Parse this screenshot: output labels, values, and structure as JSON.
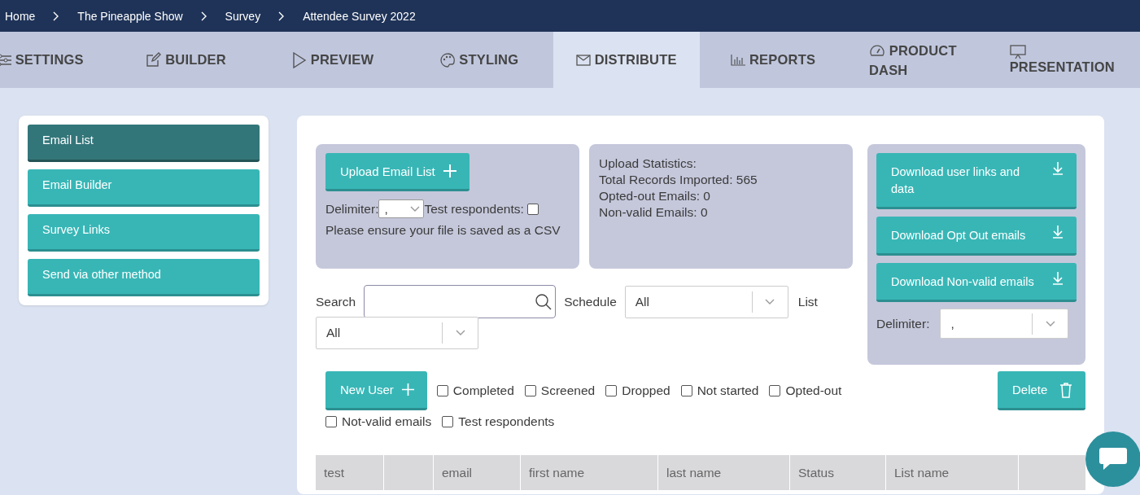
{
  "breadcrumbs": [
    "Home",
    "The Pineapple Show",
    "Survey",
    "Attendee Survey 2022"
  ],
  "tabs": [
    {
      "label": "SETTINGS",
      "selected": false
    },
    {
      "label": "BUILDER",
      "selected": false
    },
    {
      "label": "PREVIEW",
      "selected": false
    },
    {
      "label": "STYLING",
      "selected": false
    },
    {
      "label": "DISTRIBUTE",
      "selected": true
    },
    {
      "label": "REPORTS",
      "selected": false
    },
    {
      "label": "PRODUCT DASH",
      "selected": false
    },
    {
      "label": "PRESENTATION",
      "selected": false
    }
  ],
  "sidebar": {
    "items": [
      {
        "label": "Email List",
        "selected": true
      },
      {
        "label": "Email Builder",
        "selected": false
      },
      {
        "label": "Survey Links",
        "selected": false
      },
      {
        "label": "Send via other method",
        "selected": false
      }
    ]
  },
  "upload": {
    "button": "Upload Email List",
    "delimiter_label": "Delimiter:",
    "delimiter_value": ",",
    "test_label": "Test respondents:",
    "test_checked": false,
    "note": "Please ensure your file is saved as a CSV"
  },
  "statistics": [
    "Upload Statistics:",
    "Total Records Imported: 565",
    "Opted-out Emails: 0",
    "Non-valid Emails: 0"
  ],
  "downloads": {
    "buttons": [
      "Download user links and data",
      "Download Opt Out emails",
      "Download Non-valid emails"
    ],
    "delimiter_label": "Delimiter:",
    "delimiter_value": ","
  },
  "filters": {
    "search_label": "Search",
    "schedule_label": "Schedule",
    "schedule_value": "All",
    "list_label": "List",
    "list_value": "All"
  },
  "actions": {
    "new_user": "New User",
    "delete": "Delete",
    "checkboxes": [
      {
        "label": "Completed",
        "checked": false
      },
      {
        "label": "Screened",
        "checked": false
      },
      {
        "label": "Dropped",
        "checked": false
      },
      {
        "label": "Not started",
        "checked": false
      },
      {
        "label": "Opted-out",
        "checked": false
      },
      {
        "label": "Not-valid emails",
        "checked": false
      },
      {
        "label": "Test respondents",
        "checked": false
      }
    ]
  },
  "table": {
    "columns": [
      {
        "label": "test"
      },
      {},
      {
        "label": "email"
      },
      {
        "label": "first name"
      },
      {
        "label": "last name"
      },
      {
        "label": "Status"
      },
      {
        "label": "List name"
      },
      {}
    ]
  }
}
